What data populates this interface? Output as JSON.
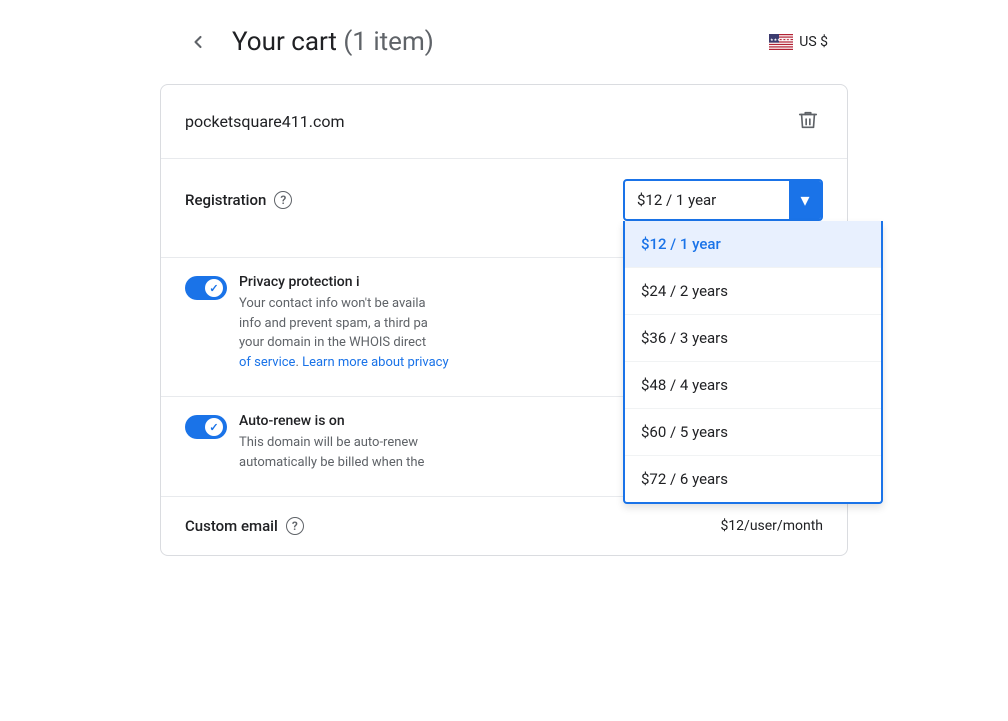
{
  "header": {
    "title": "Your cart",
    "item_count": "(1 item)",
    "back_label": "←",
    "currency": "US $"
  },
  "card": {
    "domain": {
      "name": "pocketsquare411.com",
      "delete_label": "delete"
    },
    "registration": {
      "label": "Registration",
      "help": "?",
      "selected_option": "$12 / 1 year",
      "options": [
        {
          "label": "$12 / 1 year",
          "value": "1",
          "selected": true
        },
        {
          "label": "$24 / 2 years",
          "value": "2",
          "selected": false
        },
        {
          "label": "$36 / 3 years",
          "value": "3",
          "selected": false
        },
        {
          "label": "$48 / 4 years",
          "value": "4",
          "selected": false
        },
        {
          "label": "$60 / 5 years",
          "value": "5",
          "selected": false
        },
        {
          "label": "$72 / 6 years",
          "value": "6",
          "selected": false
        }
      ]
    },
    "privacy": {
      "title": "Privacy protection i",
      "description_start": "Your contact info won't be availa",
      "description_mid": "info and prevent spam, a third pa",
      "description_mid2": "your domain in the WHOIS direct",
      "terms_link": "of service",
      "learn_link": "Learn more about priv",
      "full_desc": "Your contact info won't be available to the public. To keep your contact info and prevent spam, a third party will list your domain in the WHOIS directory instead of yours. ",
      "terms_text": "of service",
      "learn_text": "Learn more about privacy"
    },
    "autorenew": {
      "title": "Auto-renew is on",
      "description_start": "This domain will be auto-renew",
      "description_mid": "automatically be billed when the"
    },
    "custom_email": {
      "label": "Custom email",
      "help": "?",
      "price": "$12/user/month"
    }
  }
}
